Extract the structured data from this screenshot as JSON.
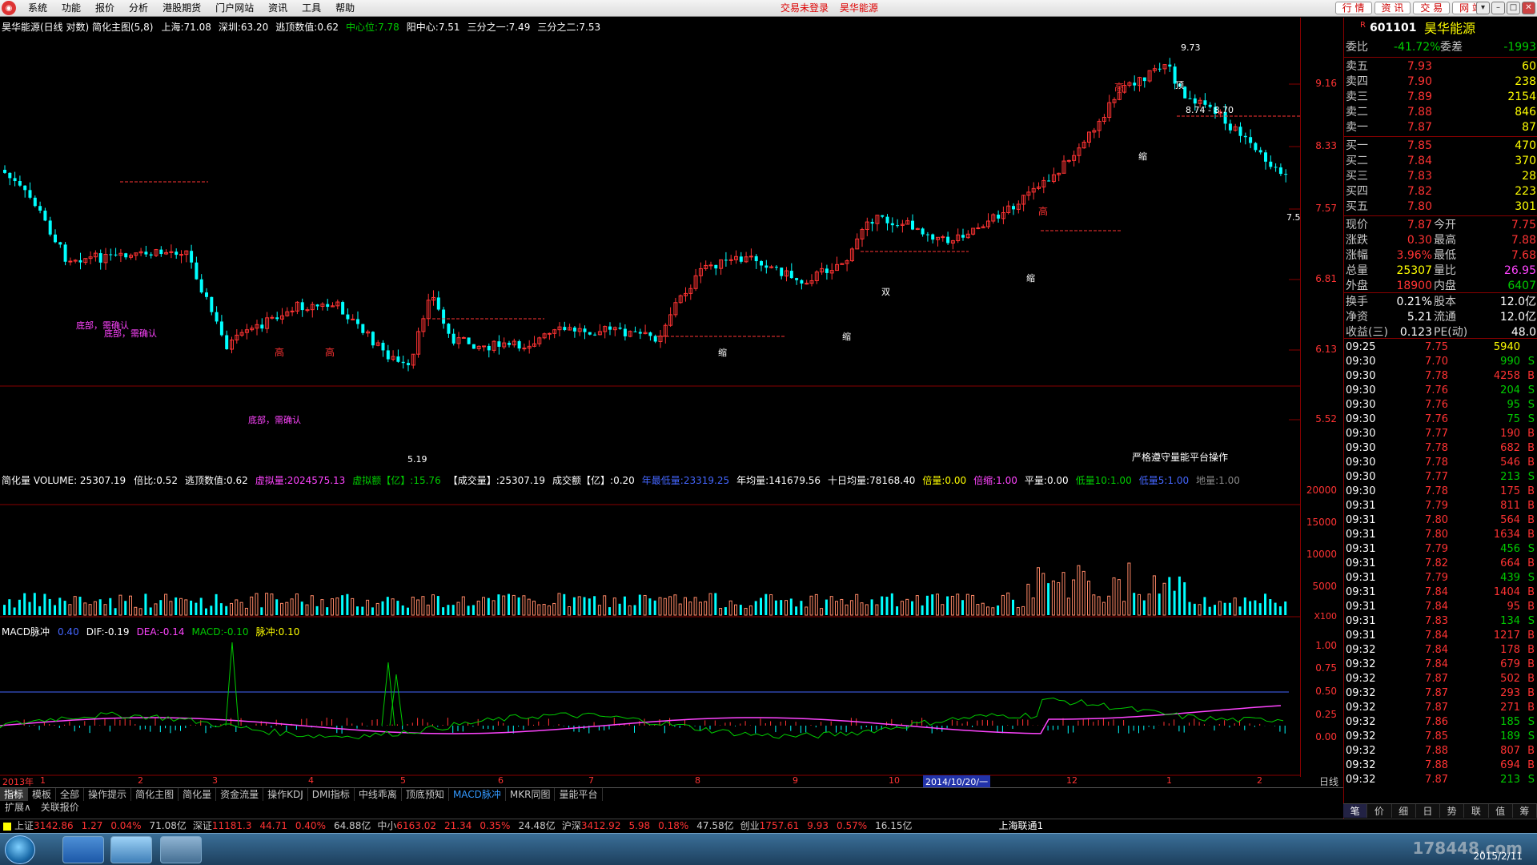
{
  "menubar": {
    "items": [
      "系统",
      "功能",
      "报价",
      "分析",
      "港股期货",
      "门户网站",
      "资讯",
      "工具",
      "帮助"
    ],
    "notice": [
      "交易未登录",
      "昊华能源"
    ],
    "right_buttons": [
      "行 情",
      "资 讯",
      "交 易",
      "网 站"
    ]
  },
  "main_title": {
    "name": "昊华能源(日线 对数) 简化主图(5,8)",
    "items": [
      {
        "label": "上海:",
        "value": "71.08",
        "color": "#ffffff"
      },
      {
        "label": "深圳:",
        "value": "63.20",
        "color": "#ffffff"
      },
      {
        "label": "逃顶数值:",
        "value": "0.62",
        "color": "#ffffff"
      },
      {
        "label": "中心位:",
        "value": "7.78",
        "color": "#00cc00"
      },
      {
        "label": "阳中心:",
        "value": "7.51",
        "color": "#ffffff"
      },
      {
        "label": "三分之一:",
        "value": "7.49",
        "color": "#ffffff"
      },
      {
        "label": "三分之二:",
        "value": "7.53",
        "color": "#ffffff"
      }
    ]
  },
  "price_axis": [
    "9.16",
    "8.33",
    "7.57",
    "6.81",
    "6.13",
    "5.52"
  ],
  "price_labels": {
    "high": "9.73",
    "low": "5.19",
    "range": "8.74 - 8.70",
    "last": "7.5",
    "note": "严格遵守量能平台操作",
    "bottom_confirm": "底部，需确认",
    "bottom_confirm2": "底部，需确认",
    "high_tag": "高",
    "shrink_tag": "缩",
    "double_tag": "双",
    "top_tag": "顶"
  },
  "volume_title": {
    "name": "简化量 VOLUME: 25307.19",
    "items": [
      {
        "label": "倍比:",
        "value": "0.52",
        "color": "#ffffff"
      },
      {
        "label": "逃顶数值:",
        "value": "0.62",
        "color": "#ffffff"
      },
      {
        "label": "虚拟量:",
        "value": "2024575.13",
        "color": "#ff44ff"
      },
      {
        "label": "虚拟额【亿】:",
        "value": "15.76",
        "color": "#00cc00"
      },
      {
        "label": "【成交量】:",
        "value": "25307.19",
        "color": "#ffffff"
      },
      {
        "label": "成交额【亿】:",
        "value": "0.20",
        "color": "#ffffff"
      },
      {
        "label": "年最低量:",
        "value": "23319.25",
        "color": "#4466ff"
      },
      {
        "label": "年均量:",
        "value": "141679.56",
        "color": "#ffffff"
      },
      {
        "label": "十日均量:",
        "value": "78168.40",
        "color": "#ffffff"
      },
      {
        "label": "倍量:",
        "value": "0.00",
        "color": "#ffff00"
      },
      {
        "label": "倍缩:",
        "value": "1.00",
        "color": "#ff44ff"
      },
      {
        "label": "平量:",
        "value": "0.00",
        "color": "#ffffff"
      },
      {
        "label": "低量10:",
        "value": "1.00",
        "color": "#00cc00"
      },
      {
        "label": "低量5:",
        "value": "1.00",
        "color": "#4466ff"
      },
      {
        "label": "地量:",
        "value": "1.00",
        "color": "#888888"
      }
    ]
  },
  "volume_axis": [
    "20000",
    "15000",
    "10000",
    "5000",
    "X100"
  ],
  "macd_title": {
    "name": "MACD脉冲",
    "items": [
      {
        "label": "",
        "value": "0.40",
        "color": "#4466ff"
      },
      {
        "label": "DIF:",
        "value": "-0.19",
        "color": "#ffffff"
      },
      {
        "label": "DEA:",
        "value": "-0.14",
        "color": "#ff44ff"
      },
      {
        "label": "MACD:",
        "value": "-0.10",
        "color": "#00cc00"
      },
      {
        "label": "脉冲:",
        "value": "0.10",
        "color": "#ffff00"
      }
    ]
  },
  "macd_axis": [
    "1.00",
    "0.75",
    "0.50",
    "0.25",
    "0.00"
  ],
  "date_axis": {
    "year": "2013年",
    "months": [
      "1",
      "2",
      "3",
      "4",
      "5",
      "6",
      "7",
      "8",
      "9",
      "10",
      "12",
      "1",
      "2"
    ],
    "cursor": "2014/10/20/一",
    "right": "日线"
  },
  "tabs_row1": [
    "指标",
    "模板",
    "全部",
    "操作提示",
    "简化主图",
    "简化量",
    "资金流量",
    "操作KDJ",
    "DMI指标",
    "中线乖离",
    "顶底预知",
    "MACD脉冲",
    "MKR同图",
    "量能平台"
  ],
  "tabs_row2": [
    "扩展∧",
    "关联报价"
  ],
  "right_panel": {
    "code": "601101",
    "name": "昊华能源",
    "weibi": {
      "label": "委比",
      "value": "-41.72%",
      "label2": "委差",
      "value2": "-1993"
    },
    "asks": [
      {
        "label": "卖五",
        "price": "7.93",
        "vol": "60"
      },
      {
        "label": "卖四",
        "price": "7.90",
        "vol": "238"
      },
      {
        "label": "卖三",
        "price": "7.89",
        "vol": "2154"
      },
      {
        "label": "卖二",
        "price": "7.88",
        "vol": "846"
      },
      {
        "label": "卖一",
        "price": "7.87",
        "vol": "87"
      }
    ],
    "bids": [
      {
        "label": "买一",
        "price": "7.85",
        "vol": "470"
      },
      {
        "label": "买二",
        "price": "7.84",
        "vol": "370"
      },
      {
        "label": "买三",
        "price": "7.83",
        "vol": "28"
      },
      {
        "label": "买四",
        "price": "7.82",
        "vol": "223"
      },
      {
        "label": "买五",
        "price": "7.80",
        "vol": "301"
      }
    ],
    "quote": [
      {
        "l1": "现价",
        "v1": "7.87",
        "c1": "#ff3333",
        "l2": "今开",
        "v2": "7.75",
        "c2": "#ff3333"
      },
      {
        "l1": "涨跌",
        "v1": "0.30",
        "c1": "#ff3333",
        "l2": "最高",
        "v2": "7.88",
        "c2": "#ff3333"
      },
      {
        "l1": "涨幅",
        "v1": "3.96%",
        "c1": "#ff3333",
        "l2": "最低",
        "v2": "7.68",
        "c2": "#ff3333"
      },
      {
        "l1": "总量",
        "v1": "25307",
        "c1": "#ffff00",
        "l2": "量比",
        "v2": "26.95",
        "c2": "#ff44ff"
      },
      {
        "l1": "外盘",
        "v1": "18900",
        "c1": "#ff3333",
        "l2": "内盘",
        "v2": "6407",
        "c2": "#00cc00"
      }
    ],
    "fundamentals": [
      {
        "l1": "换手",
        "v1": "0.21%",
        "l2": "股本",
        "v2": "12.0亿"
      },
      {
        "l1": "净资",
        "v1": "5.21",
        "l2": "流通",
        "v2": "12.0亿"
      },
      {
        "l1": "收益(三)",
        "v1": "0.123",
        "l2": "PE(动)",
        "v2": "48.0"
      }
    ],
    "ticks": [
      {
        "t": "09:25",
        "p": "7.75",
        "v": "5940",
        "d": ""
      },
      {
        "t": "09:30",
        "p": "7.70",
        "v": "990",
        "d": "S"
      },
      {
        "t": "09:30",
        "p": "7.78",
        "v": "4258",
        "d": "B"
      },
      {
        "t": "09:30",
        "p": "7.76",
        "v": "204",
        "d": "S"
      },
      {
        "t": "09:30",
        "p": "7.76",
        "v": "95",
        "d": "S"
      },
      {
        "t": "09:30",
        "p": "7.76",
        "v": "75",
        "d": "S"
      },
      {
        "t": "09:30",
        "p": "7.77",
        "v": "190",
        "d": "B"
      },
      {
        "t": "09:30",
        "p": "7.78",
        "v": "682",
        "d": "B"
      },
      {
        "t": "09:30",
        "p": "7.78",
        "v": "546",
        "d": "B"
      },
      {
        "t": "09:30",
        "p": "7.77",
        "v": "213",
        "d": "S"
      },
      {
        "t": "09:30",
        "p": "7.78",
        "v": "175",
        "d": "B"
      },
      {
        "t": "09:31",
        "p": "7.79",
        "v": "811",
        "d": "B"
      },
      {
        "t": "09:31",
        "p": "7.80",
        "v": "564",
        "d": "B"
      },
      {
        "t": "09:31",
        "p": "7.80",
        "v": "1634",
        "d": "B"
      },
      {
        "t": "09:31",
        "p": "7.79",
        "v": "456",
        "d": "S"
      },
      {
        "t": "09:31",
        "p": "7.82",
        "v": "664",
        "d": "B"
      },
      {
        "t": "09:31",
        "p": "7.79",
        "v": "439",
        "d": "S"
      },
      {
        "t": "09:31",
        "p": "7.84",
        "v": "1404",
        "d": "B"
      },
      {
        "t": "09:31",
        "p": "7.84",
        "v": "95",
        "d": "B"
      },
      {
        "t": "09:31",
        "p": "7.83",
        "v": "134",
        "d": "S"
      },
      {
        "t": "09:31",
        "p": "7.84",
        "v": "1217",
        "d": "B"
      },
      {
        "t": "09:32",
        "p": "7.84",
        "v": "178",
        "d": "B"
      },
      {
        "t": "09:32",
        "p": "7.84",
        "v": "679",
        "d": "B"
      },
      {
        "t": "09:32",
        "p": "7.87",
        "v": "502",
        "d": "B"
      },
      {
        "t": "09:32",
        "p": "7.87",
        "v": "293",
        "d": "B"
      },
      {
        "t": "09:32",
        "p": "7.87",
        "v": "271",
        "d": "B"
      },
      {
        "t": "09:32",
        "p": "7.86",
        "v": "185",
        "d": "S"
      },
      {
        "t": "09:32",
        "p": "7.85",
        "v": "189",
        "d": "S"
      },
      {
        "t": "09:32",
        "p": "7.88",
        "v": "807",
        "d": "B"
      },
      {
        "t": "09:32",
        "p": "7.88",
        "v": "694",
        "d": "B"
      },
      {
        "t": "09:32",
        "p": "7.87",
        "v": "213",
        "d": "S"
      }
    ],
    "bottom_tabs": [
      "笔",
      "价",
      "细",
      "日",
      "势",
      "联",
      "值",
      "筹"
    ]
  },
  "status_bar": [
    {
      "name": "上证",
      "value": "3142.86",
      "change": "1.27",
      "pct": "0.04%",
      "amount": "71.08亿"
    },
    {
      "name": "深证",
      "value": "11181.3",
      "change": "44.71",
      "pct": "0.40%",
      "amount": "64.88亿"
    },
    {
      "name": "中小",
      "value": "6163.02",
      "change": "21.34",
      "pct": "0.35%",
      "amount": "24.48亿"
    },
    {
      "name": "沪深",
      "value": "3412.92",
      "change": "5.98",
      "pct": "0.18%",
      "amount": "47.58亿"
    },
    {
      "name": "创业",
      "value": "1757.61",
      "change": "9.93",
      "pct": "0.57%",
      "amount": "16.15亿"
    }
  ],
  "status_right": "上海联通1",
  "taskbar": {
    "date": "2015/2/11",
    "watermark": "178448.com"
  },
  "colors": {
    "up": "#ff3333",
    "down": "#00ffff",
    "yellow": "#ffff00",
    "green": "#00cc00",
    "magenta": "#ff44ff",
    "grid": "#800000"
  }
}
